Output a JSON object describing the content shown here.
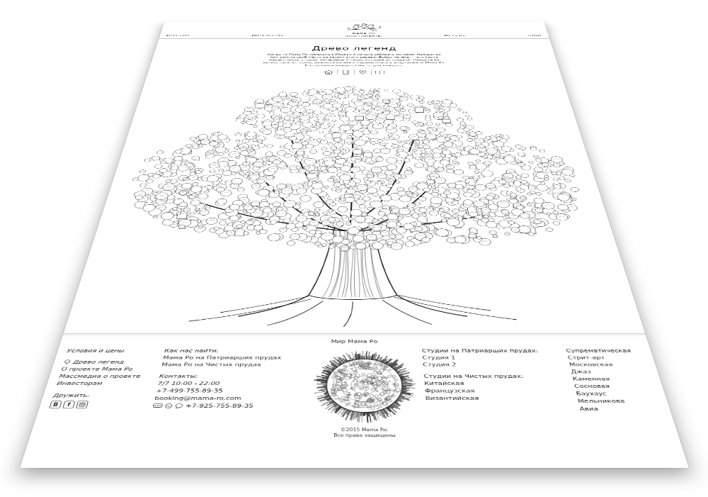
{
  "logo": {
    "line1": "МАМА РО",
    "line2": "АПАРТАМЕНТЫ"
  },
  "nav": [
    "АРТСТОР",
    "ИНТЕРЬЕРЫ",
    "МЕБЕЛЬ",
    "БЛОГ"
  ],
  "hero": {
    "title": "Древо легенд",
    "text": "Когда-то Мама Ро приехала в Москву и начала собирать истории. Каждая из них заняла своё место на ветвях этого дерева. Древо легенд — это карта нашего мира: студии, интерьеры и люди, которые их создали. Найдите на ветвях свою историю, нажмите на неё и перенеситесь в апартаменты Мама Ро. В этой книге найдётся место для каждого."
  },
  "footer": {
    "title": "Мир Мама Ро",
    "links": [
      "Условия и цены",
      "Древо легенд",
      "О проекте Мама Ро",
      "Массмедиа о проекте",
      "Инвесторам"
    ],
    "social_label": "Дружить:",
    "social": [
      {
        "kind": "letter",
        "glyph": "B"
      },
      {
        "kind": "letter",
        "glyph": "f"
      },
      {
        "kind": "camera",
        "glyph": ""
      }
    ],
    "find": {
      "title": "Как нас найти:",
      "items": [
        "Мама Ро на Патриарших прудах",
        "Мама Ро на Чистых прудах"
      ]
    },
    "contacts": {
      "title": "Контакты:",
      "hours": "7/7 10:00 - 22:00",
      "phone": "+7-499-755-89-35",
      "email": "booking@mama-ro.com",
      "messenger_phone": "+7-925-755-89-35"
    },
    "studios": [
      {
        "title": "Студии на Патриарших прудах:",
        "items": [
          "Студия 1",
          "Студия 2"
        ]
      },
      {
        "title": "Студии на Чистых прудах:",
        "items": [
          "Китайская",
          "Французская",
          "Византийская"
        ]
      }
    ],
    "styles": [
      "Супрематическая",
      "Стрит-арт",
      "Московская",
      "Джаз",
      "Каменная",
      "Сосновая",
      "Баухаус",
      "Мельникова",
      "Авиа"
    ],
    "copyright": [
      "©2015 Mama Ro.",
      "Все права защищены"
    ]
  }
}
